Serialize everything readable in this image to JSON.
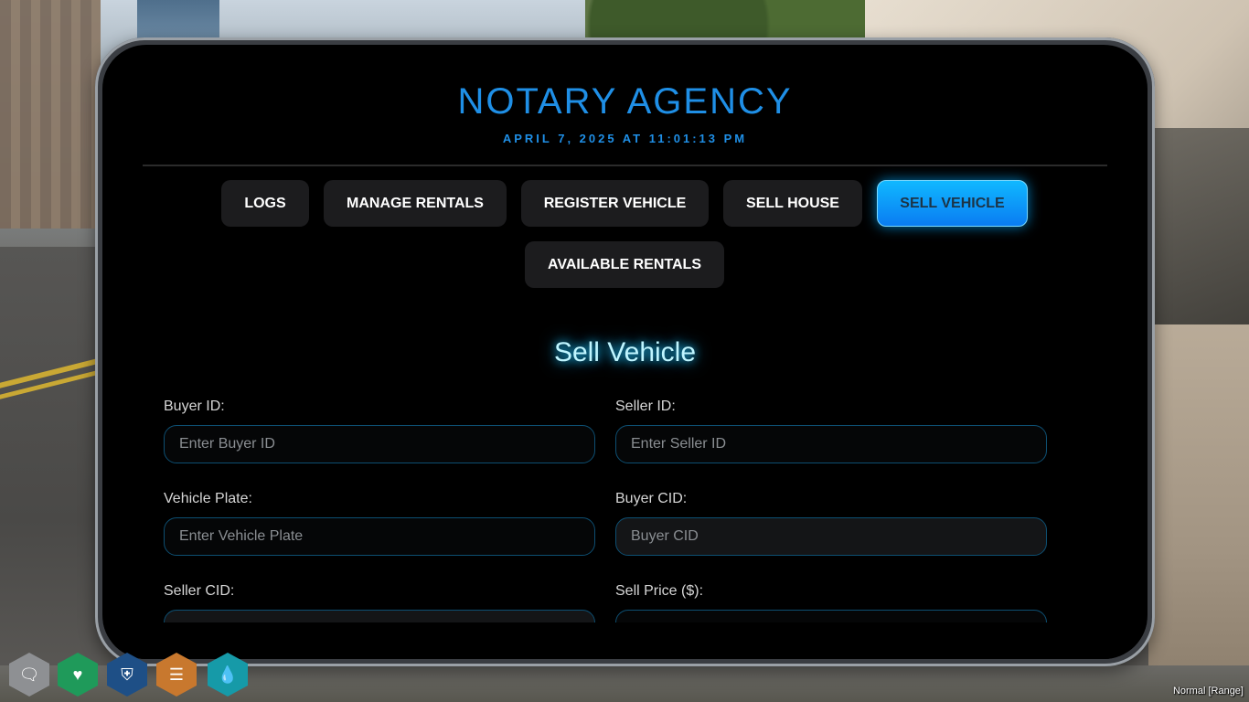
{
  "app": {
    "title": "NOTARY AGENCY",
    "datetime": "APRIL 7, 2025 AT 11:01:13 PM"
  },
  "tabs": [
    {
      "label": "LOGS",
      "active": false
    },
    {
      "label": "MANAGE RENTALS",
      "active": false
    },
    {
      "label": "REGISTER VEHICLE",
      "active": false
    },
    {
      "label": "SELL HOUSE",
      "active": false
    },
    {
      "label": "SELL VEHICLE",
      "active": true
    },
    {
      "label": "AVAILABLE RENTALS",
      "active": false
    }
  ],
  "form": {
    "title": "Sell Vehicle",
    "fields": [
      {
        "label": "Buyer ID:",
        "placeholder": "Enter Buyer ID",
        "value": ""
      },
      {
        "label": "Seller ID:",
        "placeholder": "Enter Seller ID",
        "value": ""
      },
      {
        "label": "Vehicle Plate:",
        "placeholder": "Enter Vehicle Plate",
        "value": ""
      },
      {
        "label": "Buyer CID:",
        "placeholder": "Buyer CID",
        "value": ""
      },
      {
        "label": "Seller CID:",
        "placeholder": "",
        "value": ""
      },
      {
        "label": "Sell Price ($):",
        "placeholder": "",
        "value": ""
      }
    ]
  },
  "hud": {
    "icons": [
      {
        "name": "voice-icon",
        "glyph": "🗨",
        "color": "#8e9093"
      },
      {
        "name": "health-icon",
        "glyph": "♥",
        "color": "#1f9a5a"
      },
      {
        "name": "armor-icon",
        "glyph": "⛨",
        "color": "#1e4f86"
      },
      {
        "name": "hunger-icon",
        "glyph": "☰",
        "color": "#c8782e"
      },
      {
        "name": "thirst-icon",
        "glyph": "💧",
        "color": "#169aa8"
      }
    ],
    "status_text": "Normal [Range]"
  },
  "colors": {
    "accent": "#1f8fe6",
    "active_tab": "#0a9cf7",
    "glow": "#27c7ff"
  }
}
